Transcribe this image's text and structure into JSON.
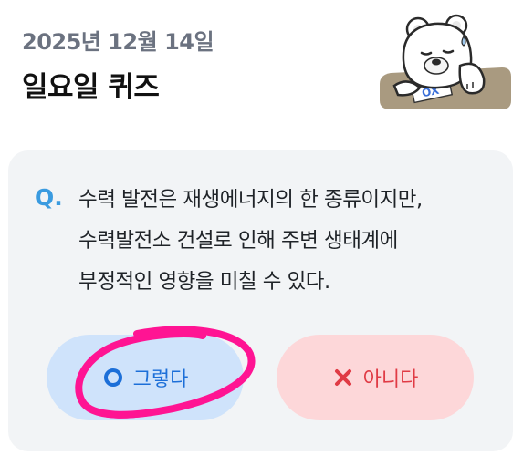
{
  "header": {
    "date": "2025년 12월 14일",
    "title": "일요일 퀴즈"
  },
  "mascot": {
    "icon": "sleepy-bear-icon",
    "card_text": "OX"
  },
  "quiz": {
    "q_mark": "Q.",
    "question_lines": [
      "수력 발전은 재생에너지의 한 종류이지만,",
      "수력발전소 건설로 인해 주변 생태계에",
      "부정적인 영향을 미칠 수 있다."
    ]
  },
  "answers": {
    "yes": {
      "label": "그렇다",
      "icon": "circle-o-icon",
      "color": "#1c6fd8",
      "bg": "#cfe3fb"
    },
    "no": {
      "label": "아니다",
      "icon": "x-mark-icon",
      "color": "#e03b45",
      "bg": "#fdd7d9"
    }
  },
  "annotation": {
    "color": "#ff1493",
    "icon": "hand-drawn-circle"
  }
}
